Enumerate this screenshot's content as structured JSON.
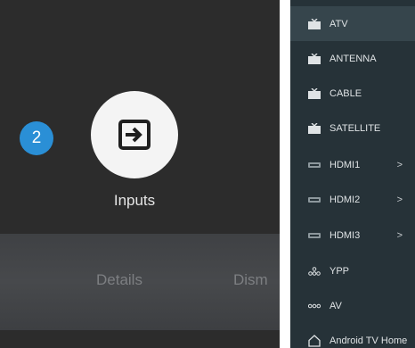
{
  "notification": {
    "count": "2",
    "title": "Inputs",
    "actions": [
      "Details",
      "Dism"
    ]
  },
  "input_list": [
    {
      "label": "ATV",
      "icon": "tv-icon",
      "chevron": ""
    },
    {
      "label": "ANTENNA",
      "icon": "tv-icon",
      "chevron": ""
    },
    {
      "label": "CABLE",
      "icon": "tv-icon",
      "chevron": ""
    },
    {
      "label": "SATELLITE",
      "icon": "tv-icon",
      "chevron": ""
    },
    {
      "label": "HDMI1",
      "icon": "hdmi-icon",
      "chevron": ">"
    },
    {
      "label": "HDMI2",
      "icon": "hdmi-icon",
      "chevron": ">"
    },
    {
      "label": "HDMI3",
      "icon": "hdmi-icon",
      "chevron": ">"
    },
    {
      "label": "YPP",
      "icon": "component-icon",
      "chevron": ""
    },
    {
      "label": "AV",
      "icon": "composite-icon",
      "chevron": ""
    },
    {
      "label": "Android TV Home",
      "icon": "home-icon",
      "chevron": ""
    }
  ],
  "colors": {
    "badge": "#2a8fd6",
    "list_background": "#263238",
    "selected_item": "#36454c"
  }
}
